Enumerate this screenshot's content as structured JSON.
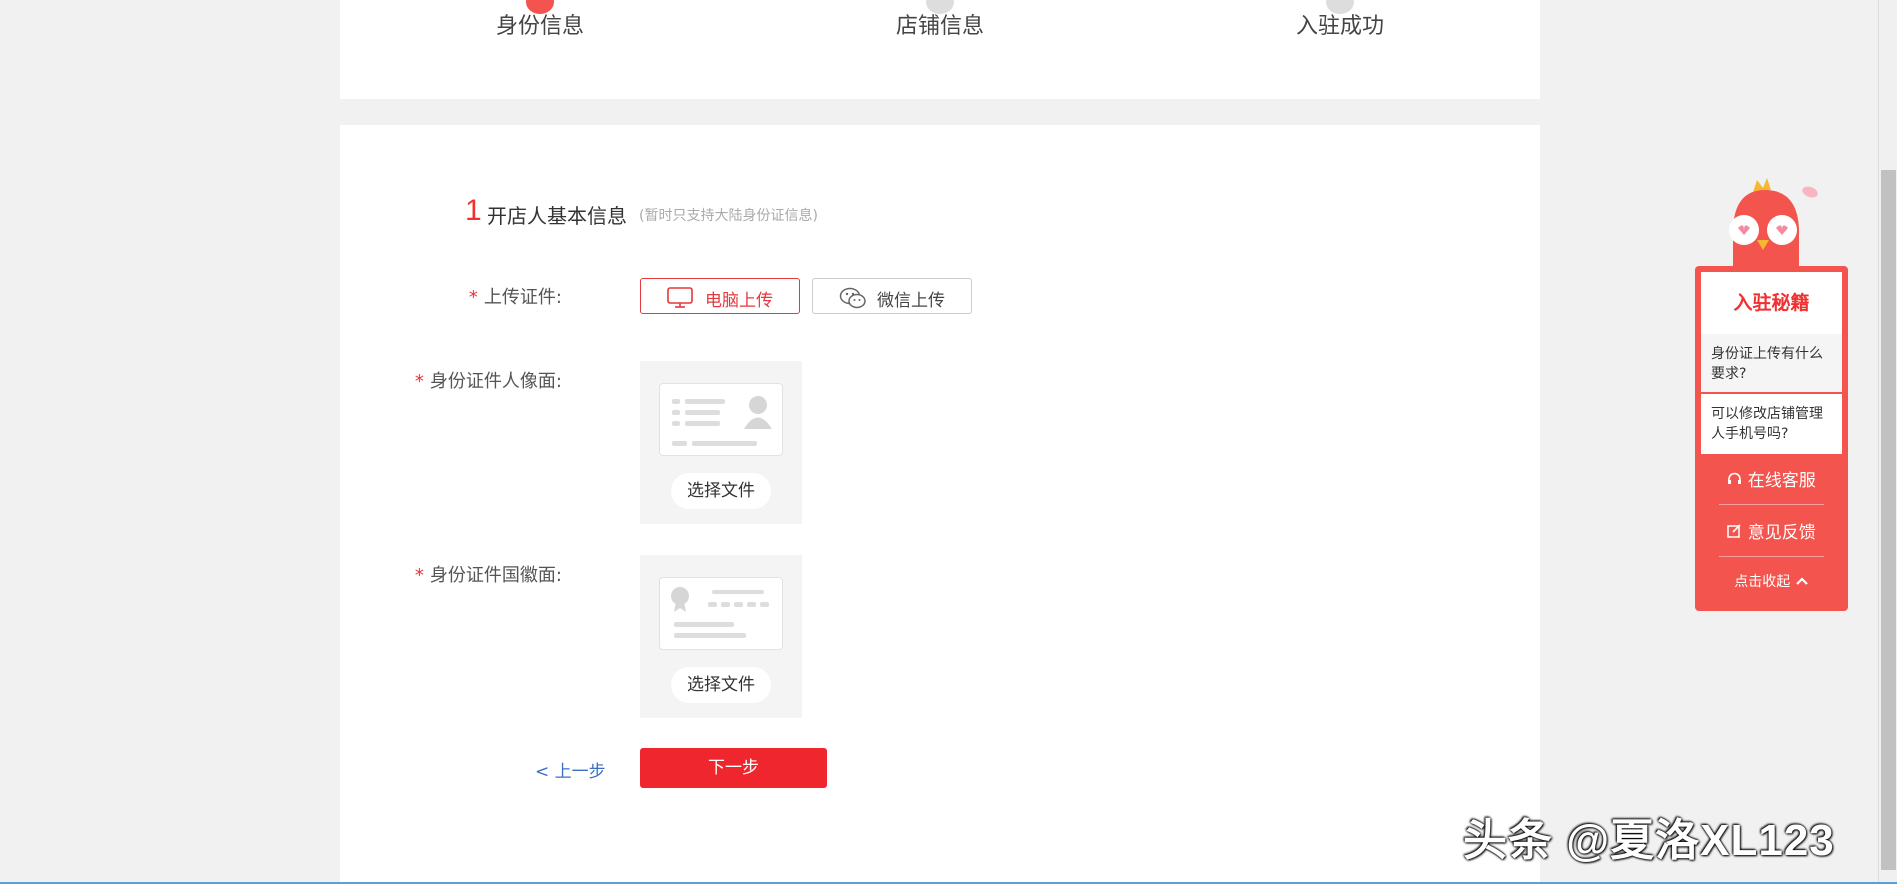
{
  "steps": [
    {
      "label": "身份信息",
      "color": "#f4544e"
    },
    {
      "label": "店铺信息",
      "color": "#cccccc"
    },
    {
      "label": "入驻成功",
      "color": "#cccccc"
    }
  ],
  "section": {
    "number": "1",
    "title": "开店人基本信息",
    "hint": "(暂时只支持大陆身份证信息)"
  },
  "form": {
    "required_mark": "*",
    "upload_label": "上传证件:",
    "upload_pc": "电脑上传",
    "upload_wechat": "微信上传",
    "front_label": "身份证件人像面:",
    "back_label": "身份证件国徽面:",
    "choose_file": "选择文件",
    "prev": "< 上一步",
    "next": "下一步"
  },
  "widget": {
    "title": "入驻秘籍",
    "faq": [
      "身份证上传有什么要求?",
      "可以修改店铺管理人手机号吗?"
    ],
    "service": "在线客服",
    "feedback": "意见反馈",
    "collapse": "点击收起"
  },
  "watermark": "头条 @夏洛XL123",
  "colors": {
    "accent": "#f23030",
    "widget": "#f4544e",
    "link": "#3a6fc4"
  }
}
